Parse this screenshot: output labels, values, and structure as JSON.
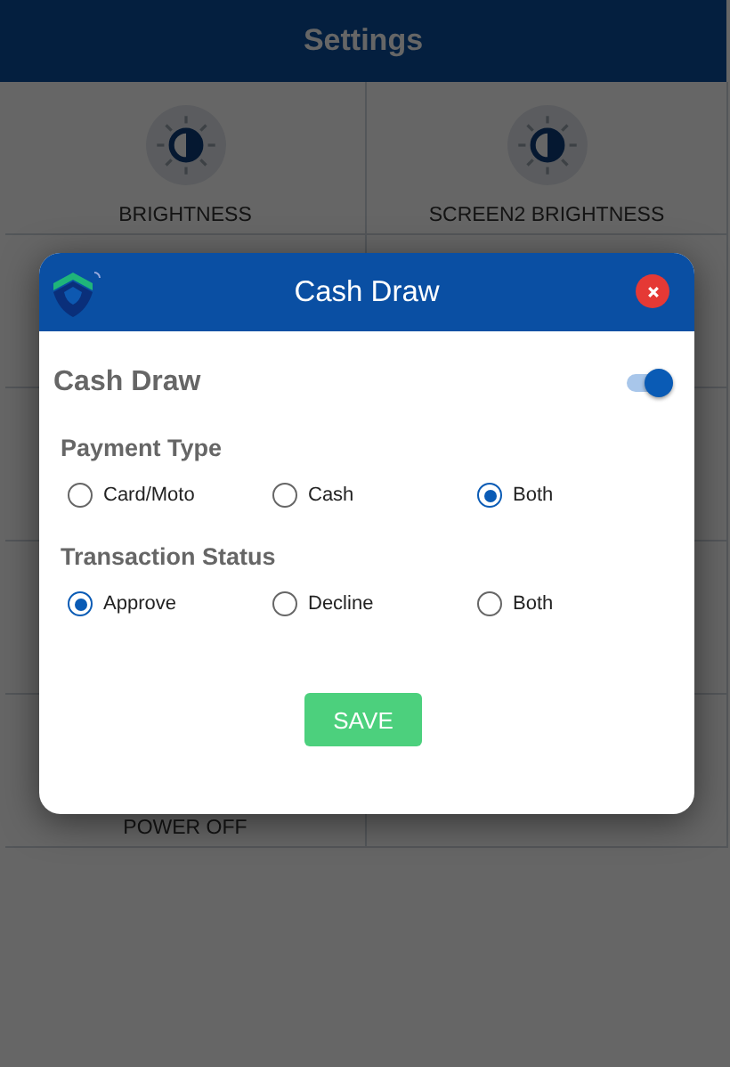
{
  "app_bar": {
    "title": "Settings"
  },
  "tiles": [
    {
      "kind": "brightness",
      "label": "BRIGHTNESS"
    },
    {
      "kind": "brightness",
      "label": "SCREEN2 BRIGHTNESS"
    },
    {
      "kind": "plain",
      "label": "POWER OFF"
    }
  ],
  "dialog": {
    "title": "Cash Draw",
    "setting": {
      "label": "Cash Draw",
      "on": true
    },
    "groups": [
      {
        "label": "Payment Type",
        "options": [
          {
            "label": "Card/Moto",
            "selected": false
          },
          {
            "label": "Cash",
            "selected": false
          },
          {
            "label": "Both",
            "selected": true
          }
        ]
      },
      {
        "label": "Transaction Status",
        "options": [
          {
            "label": "Approve",
            "selected": true
          },
          {
            "label": "Decline",
            "selected": false
          },
          {
            "label": "Both",
            "selected": false
          }
        ]
      }
    ],
    "save_button": "SAVE"
  }
}
